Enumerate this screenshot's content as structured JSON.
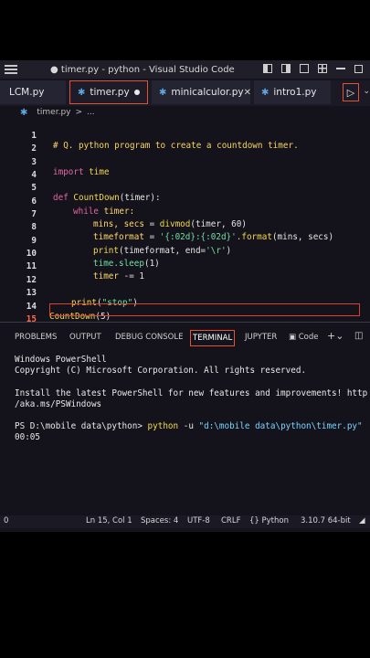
{
  "window": {
    "title": "● timer.py - python - Visual Studio Code"
  },
  "tabs": [
    {
      "label": "LCM.py"
    },
    {
      "label": "timer.py"
    },
    {
      "label": "minicalculor.py"
    },
    {
      "label": "intro1.py"
    }
  ],
  "breadcrumb": {
    "file": "timer.py",
    "sep": ">",
    "rest": "..."
  },
  "editor": {
    "line_numbers": [
      "1",
      "2",
      "3",
      "4",
      "5",
      "6",
      "7",
      "8",
      "9",
      "10",
      "11",
      "12",
      "13",
      "14",
      "15"
    ],
    "code": {
      "l1": "# Q. python program to create a countdown timer.",
      "l3_kw": "import",
      "l3_mod": "time",
      "l5_kw": "def",
      "l5_fn": "CountDown",
      "l5_rest": "(timer):",
      "l6_kw": "while",
      "l6_rest": "timer:",
      "l7_var": "mins, secs",
      "l7_op": " = ",
      "l7_fn": "divmod",
      "l7_rest": "(timer, 60)",
      "l8_var": "timeformat",
      "l8_op": " = ",
      "l8_str": "'{:02d}:{:02d}'",
      "l8_fn": ".format",
      "l8_rest": "(mins, secs)",
      "l9_fn": "print",
      "l9_rest": "(timeformat, end=",
      "l9_str": "'\\r'",
      "l9_end": ")",
      "l10_fn": "time.sleep",
      "l10_rest": "(1)",
      "l11_var": "timer",
      "l11_op": " -= 1",
      "l13_fn": "print",
      "l13_p1": "(",
      "l13_str": "\"stop\"",
      "l13_p2": ")",
      "l14_fn": "CountDown",
      "l14_rest": "(5)"
    }
  },
  "panel": {
    "tabs": {
      "problems": "PROBLEMS",
      "output": "OUTPUT",
      "debug": "DEBUG CONSOLE",
      "terminal": "TERMINAL",
      "jupyter": "JUPYTER",
      "code": "Code"
    },
    "terminal": {
      "l1": "Windows PowerShell",
      "l2": "Copyright (C) Microsoft Corporation. All rights reserved.",
      "l3": "Install the latest PowerShell for new features and improvements! http",
      "l4": "/aka.ms/PSWindows",
      "prompt": "PS D:\\mobile data\\python> ",
      "cmd": "python",
      "flag": " -u ",
      "path": "\"d:\\mobile data\\python\\timer.py\"",
      "output": "00:05"
    }
  },
  "statusbar": {
    "left": "0",
    "position": "Ln 15, Col 1",
    "spaces": "Spaces: 4",
    "encoding": "UTF-8",
    "eol": "CRLF",
    "language": "Python",
    "interpreter": "3.10.7 64-bit"
  }
}
